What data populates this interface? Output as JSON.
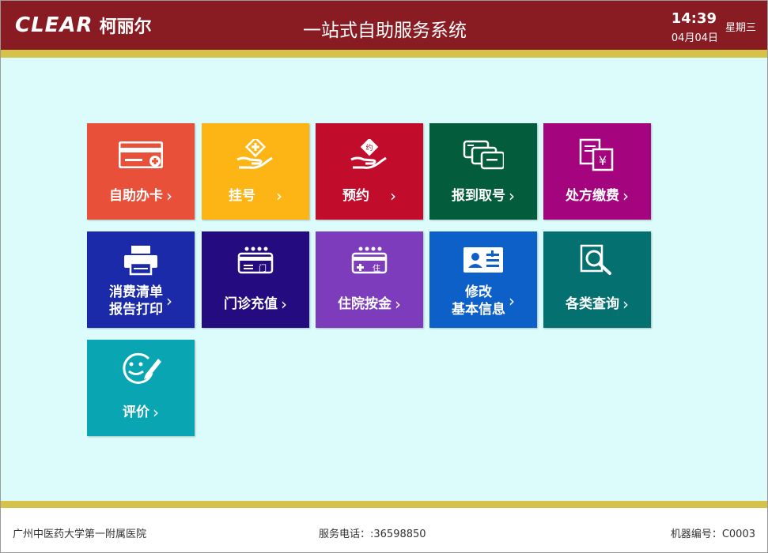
{
  "header": {
    "logo_text": "CLEAR",
    "logo_cn": "柯丽尔",
    "title": "一站式自助服务系统",
    "time": "14:39",
    "date": "04月04日",
    "weekday": "星期三"
  },
  "tiles": [
    {
      "label": "自助办卡",
      "icon": "id-card-icon",
      "color": "#e8503a"
    },
    {
      "label": "挂号",
      "icon": "hand-plus-icon",
      "color": "#fcb514"
    },
    {
      "label": "预约",
      "icon": "hand-appointment-icon",
      "color": "#c20c2c"
    },
    {
      "label": "报到取号",
      "icon": "cards-queue-icon",
      "color": "#035c3c"
    },
    {
      "label": "处方缴费",
      "icon": "prescription-yen-icon",
      "color": "#a4047e"
    },
    {
      "label": "消费清单",
      "label2": "报告打印",
      "icon": "printer-icon",
      "color": "#1a2aa8"
    },
    {
      "label": "门诊充值",
      "icon": "outpatient-recharge-icon",
      "color": "#240c80"
    },
    {
      "label": "住院按金",
      "icon": "inpatient-deposit-icon",
      "color": "#7c3cbc"
    },
    {
      "label": "修改",
      "label2": "基本信息",
      "icon": "id-edit-icon",
      "color": "#0c60c8"
    },
    {
      "label": "各类查询",
      "icon": "search-document-icon",
      "color": "#047070"
    },
    {
      "label": "评价",
      "icon": "smiley-pen-icon",
      "color": "#0aa5b2"
    }
  ],
  "footer": {
    "hospital": "广州中医药大学第一附属医院",
    "phone": "服务电话：:36598850",
    "machine": "机器编号：C0003"
  },
  "chevron": "›"
}
